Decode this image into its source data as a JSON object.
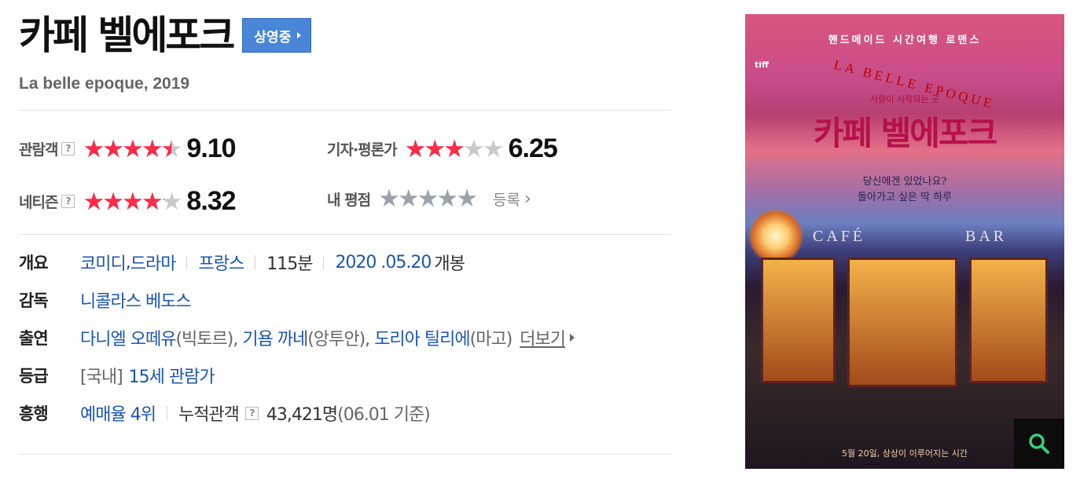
{
  "movie": {
    "title": "카페 벨에포크",
    "status_label": "상영중",
    "subtitle": "La belle epoque, 2019"
  },
  "ratings": {
    "audience": {
      "label": "관람객",
      "score": "9.10",
      "fill": 0.91
    },
    "critic": {
      "label": "기자·평론가",
      "score": "6.25",
      "fill": 0.625
    },
    "netizen": {
      "label": "네티즌",
      "score": "8.32",
      "fill": 0.832
    },
    "mine": {
      "label": "내 평점",
      "register_label": "등록",
      "fill": 0
    },
    "help_icon": "?"
  },
  "info": {
    "overview": {
      "head": "개요",
      "genre1": "코미디",
      "genre_comma": ",",
      "genre2": "드라마",
      "country": "프랑스",
      "runtime": "115분",
      "release_date": "2020 .05.20",
      "release_suffix": "개봉"
    },
    "director": {
      "head": "감독",
      "name": "니콜라스 베도스"
    },
    "cast": {
      "head": "출연",
      "actor1": "다니엘 오떼유",
      "role1": "(빅토르),",
      "actor2": "기욤 까네",
      "role2": "(앙투안),",
      "actor3": "도리아 틸리에",
      "role3": "(마고)",
      "more_label": "더보기"
    },
    "rating": {
      "head": "등급",
      "prefix": "[국내]",
      "grade": "15세 관람가"
    },
    "box_office": {
      "head": "흥행",
      "rank": "예매율 4위",
      "audience_label": "누적관객",
      "audience_count": "43,421명",
      "audience_note": "(06.01 기준)"
    }
  },
  "poster": {
    "top_text": "핸드메이드 시간여행 로맨스",
    "festival": "tiff",
    "arc_text": "LA BELLE EPOQUE",
    "tagline": "사랑이 시작되는 곳",
    "title": "카페 벨에포크",
    "quote_line1": "당신에겐 있었나요?",
    "quote_line2": "돌아가고 싶은 딱 하루",
    "sign_left": "CAFÉ",
    "sign_right": "BAR",
    "bottom_text": "5월 20일, 상상이 이루어지는 시간"
  },
  "colors": {
    "star_active": "#ff2a48",
    "star_inactive": "#c9c9c9",
    "link": "#1a55b3",
    "status_button": "#4a86d8"
  },
  "icons": {
    "status_arrow": "right-triangle-icon",
    "register_arrow": "chevron-right-icon",
    "more_arrow": "right-triangle-icon",
    "zoom": "magnifier-icon",
    "help": "question-mark-icon"
  }
}
